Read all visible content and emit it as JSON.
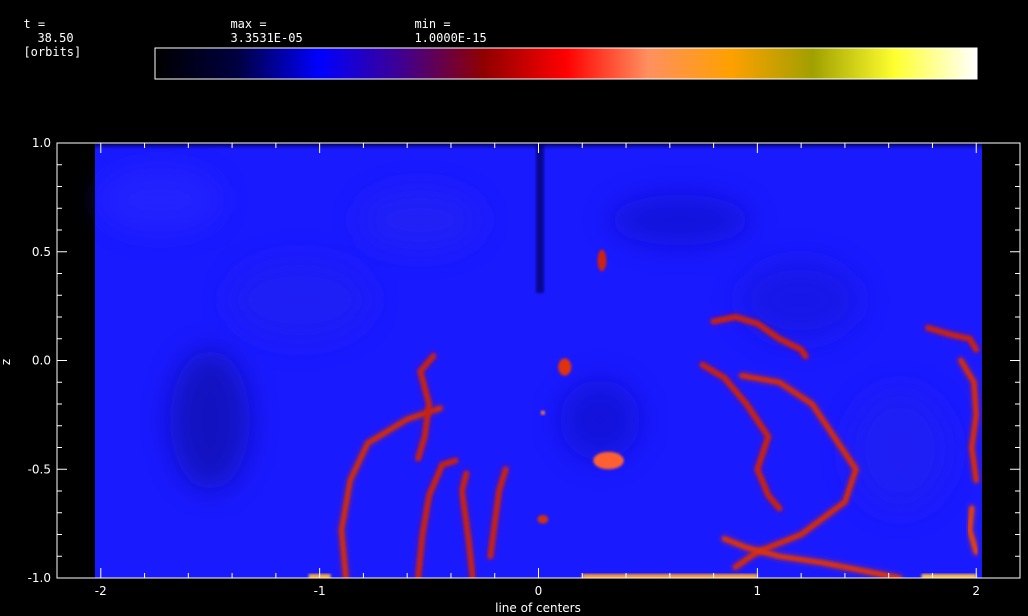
{
  "header": {
    "time_label": "t =",
    "time_value": "38.50",
    "time_unit": "[orbits]",
    "max_label": "max =",
    "max_value": "3.3531E-05",
    "min_label": "min =",
    "min_value": "1.0000E-15"
  },
  "colorbar": {
    "stops": [
      "#000000",
      "#000040",
      "#0000ff",
      "#400090",
      "#900000",
      "#ff0000",
      "#ff9060",
      "#ffa000",
      "#a0a000",
      "#ffff30",
      "#ffffff"
    ]
  },
  "chart_data": {
    "type": "heatmap",
    "title": "",
    "xlabel": "line of centers",
    "ylabel": "z",
    "xlim": [
      -2.2,
      2.2
    ],
    "ylim": [
      -1.0,
      1.0
    ],
    "x_ticks": [
      "-2",
      "-1",
      "0",
      "1",
      "2"
    ],
    "y_ticks": [
      "-1.0",
      "-0.5",
      "0.0",
      "0.5",
      "1.0"
    ],
    "x_tick_values": [
      -2,
      -1,
      0,
      1,
      2
    ],
    "y_tick_values": [
      -1.0,
      -0.5,
      0.0,
      0.5,
      1.0
    ],
    "background_color": "#1a1aff",
    "features": [
      {
        "kind": "filament",
        "color": "#cc2a10",
        "points": [
          [
            -0.88,
            -1.0
          ],
          [
            -0.9,
            -0.78
          ],
          [
            -0.86,
            -0.55
          ],
          [
            -0.78,
            -0.38
          ],
          [
            -0.6,
            -0.27
          ],
          [
            -0.45,
            -0.22
          ]
        ]
      },
      {
        "kind": "filament",
        "color": "#c82010",
        "points": [
          [
            -0.55,
            -1.0
          ],
          [
            -0.53,
            -0.8
          ],
          [
            -0.5,
            -0.62
          ],
          [
            -0.44,
            -0.48
          ],
          [
            -0.38,
            -0.46
          ]
        ]
      },
      {
        "kind": "filament",
        "color": "#c82010",
        "points": [
          [
            -0.55,
            -0.45
          ],
          [
            -0.52,
            -0.35
          ],
          [
            -0.5,
            -0.2
          ],
          [
            -0.54,
            -0.05
          ],
          [
            -0.48,
            0.02
          ]
        ]
      },
      {
        "kind": "filament",
        "color": "#c82010",
        "points": [
          [
            -0.3,
            -1.0
          ],
          [
            -0.32,
            -0.82
          ],
          [
            -0.35,
            -0.6
          ],
          [
            -0.33,
            -0.52
          ]
        ]
      },
      {
        "kind": "filament",
        "color": "#c82010",
        "points": [
          [
            -0.22,
            -0.9
          ],
          [
            -0.2,
            -0.75
          ],
          [
            -0.18,
            -0.6
          ],
          [
            -0.15,
            -0.5
          ]
        ]
      },
      {
        "kind": "filament",
        "color": "#d02a10",
        "points": [
          [
            0.9,
            -0.95
          ],
          [
            1.0,
            -0.88
          ],
          [
            1.2,
            -0.8
          ],
          [
            1.4,
            -0.65
          ],
          [
            1.45,
            -0.5
          ],
          [
            1.35,
            -0.35
          ],
          [
            1.25,
            -0.2
          ],
          [
            1.1,
            -0.1
          ],
          [
            0.93,
            -0.07
          ]
        ]
      },
      {
        "kind": "filament",
        "color": "#c82010",
        "points": [
          [
            0.75,
            -0.02
          ],
          [
            0.85,
            -0.08
          ],
          [
            0.95,
            -0.2
          ],
          [
            1.05,
            -0.35
          ],
          [
            1.0,
            -0.5
          ],
          [
            1.05,
            -0.62
          ],
          [
            1.1,
            -0.68
          ]
        ]
      },
      {
        "kind": "filament",
        "color": "#d83010",
        "points": [
          [
            0.85,
            -0.82
          ],
          [
            0.95,
            -0.86
          ],
          [
            1.1,
            -0.9
          ],
          [
            1.3,
            -0.93
          ],
          [
            1.5,
            -0.97
          ],
          [
            1.65,
            -1.0
          ]
        ]
      },
      {
        "kind": "filament",
        "color": "#c82010",
        "points": [
          [
            0.8,
            0.18
          ],
          [
            0.9,
            0.2
          ],
          [
            1.0,
            0.17
          ],
          [
            1.1,
            0.1
          ],
          [
            1.2,
            0.05
          ],
          [
            1.22,
            0.02
          ]
        ]
      },
      {
        "kind": "filament",
        "color": "#c82010",
        "points": [
          [
            1.78,
            0.15
          ],
          [
            1.88,
            0.12
          ],
          [
            1.97,
            0.1
          ],
          [
            2.0,
            0.05
          ]
        ]
      },
      {
        "kind": "filament",
        "color": "#d02a10",
        "points": [
          [
            1.93,
            0.0
          ],
          [
            1.99,
            -0.1
          ],
          [
            2.0,
            -0.25
          ],
          [
            1.98,
            -0.4
          ],
          [
            2.0,
            -0.55
          ]
        ]
      },
      {
        "kind": "filament",
        "color": "#e04010",
        "points": [
          [
            1.98,
            -0.68
          ],
          [
            1.97,
            -0.78
          ],
          [
            2.0,
            -0.88
          ]
        ]
      },
      {
        "kind": "blob",
        "color": "#ff6030",
        "x": 0.32,
        "y": -0.46,
        "rx": 0.07,
        "ry": 0.04
      },
      {
        "kind": "blob",
        "color": "#e03010",
        "x": 0.12,
        "y": -0.03,
        "rx": 0.03,
        "ry": 0.04
      },
      {
        "kind": "blob",
        "color": "#d02010",
        "x": 0.29,
        "y": 0.46,
        "rx": 0.02,
        "ry": 0.05
      },
      {
        "kind": "blob",
        "color": "#ff8030",
        "x": 0.02,
        "y": -0.24,
        "rx": 0.01,
        "ry": 0.01
      },
      {
        "kind": "blob",
        "color": "#d03010",
        "x": 0.02,
        "y": -0.73,
        "rx": 0.025,
        "ry": 0.02
      },
      {
        "kind": "band",
        "color": "#ffa030",
        "x0": 0.2,
        "x1": 1.0,
        "y": -1.0
      },
      {
        "kind": "band",
        "color": "#ffb030",
        "x0": -1.05,
        "x1": -0.95,
        "y": -1.0
      },
      {
        "kind": "band",
        "color": "#ffc040",
        "x0": 1.75,
        "x1": 2.0,
        "y": -1.0
      }
    ]
  }
}
